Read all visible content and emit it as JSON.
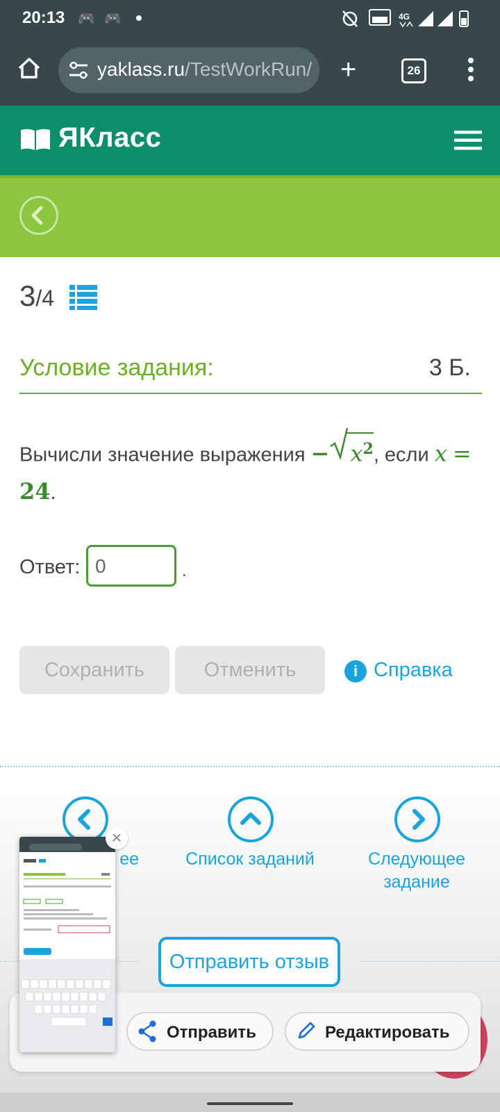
{
  "status_bar": {
    "time": "20:13",
    "tabs_count": "26"
  },
  "browser": {
    "url_domain": "yaklass.ru",
    "url_path": "/TestWorkRun/"
  },
  "header": {
    "logo": "ЯКласс"
  },
  "progress": {
    "current": "3",
    "total": "/4"
  },
  "condition": {
    "title": "Условие задания:",
    "points": "3 Б."
  },
  "task": {
    "text_before": "Вычисли значение выражения",
    "neg": "−",
    "radicand": "x",
    "exponent": "2",
    "text_middle": ", если",
    "var": "x",
    "eq": "=",
    "value": "24",
    "dot": "."
  },
  "answer": {
    "label": "Ответ:",
    "value": "0",
    "dot": "."
  },
  "buttons": {
    "save": "Сохранить",
    "cancel": "Отменить",
    "help": "Справка"
  },
  "nav": {
    "prev": "ее",
    "list": "Список заданий",
    "next_line1": "Следующее",
    "next_line2": "задание"
  },
  "feedback": {
    "label": "Отправить отзыв"
  },
  "share_panel": {
    "send": "Отправить",
    "edit": "Редактировать"
  },
  "colors": {
    "header": "#0d8f6c",
    "band": "#8cc63f",
    "accent": "#1aa3dd",
    "math": "#3d8a2e"
  }
}
